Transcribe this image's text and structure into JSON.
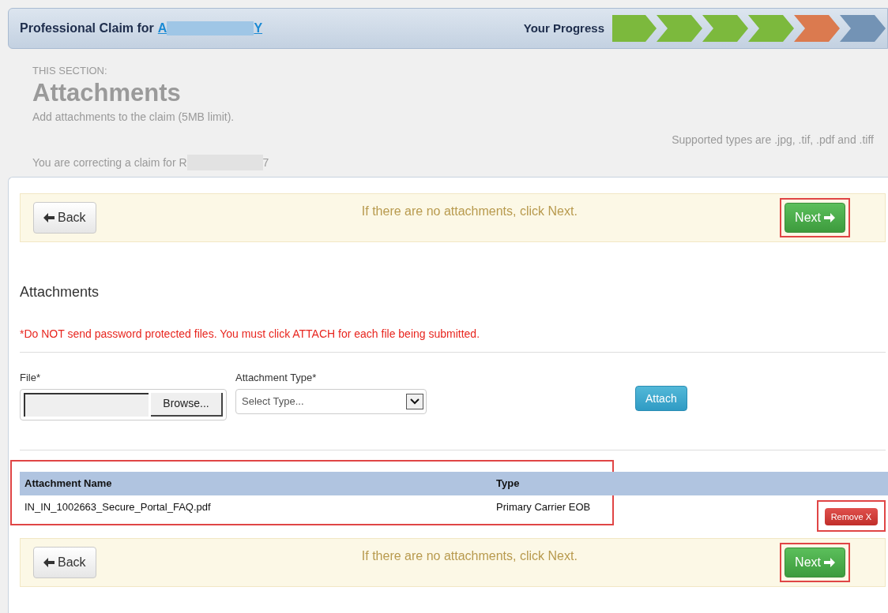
{
  "header": {
    "title": "Professional Claim for",
    "patient_link_start": "A",
    "patient_link_end": "Y",
    "progress_label": "Your Progress",
    "progress_steps": [
      {
        "kind": "done"
      },
      {
        "kind": "done"
      },
      {
        "kind": "done"
      },
      {
        "kind": "done"
      },
      {
        "kind": "current"
      },
      {
        "kind": "todo"
      }
    ]
  },
  "section": {
    "eyebrow": "THIS SECTION:",
    "title": "Attachments",
    "description": "Add attachments to the claim (5MB limit).",
    "supported_types": "Supported types are .jpg, .tif, .pdf and .tiff",
    "correcting_start": "You are correcting a claim for R",
    "correcting_end": "7"
  },
  "nav_top": {
    "back": "Back",
    "message": "If there are no attachments, click Next.",
    "next": "Next",
    "next_highlighted": true
  },
  "attachments": {
    "heading": "Attachments",
    "warning": "*Do NOT send password protected files. You must click ATTACH for each file being submitted.",
    "file_label": "File*",
    "browse": "Browse...",
    "type_label": "Attachment Type*",
    "type_placeholder": "Select Type...",
    "attach": "Attach",
    "table": {
      "highlighted": true,
      "columns": [
        "Attachment Name",
        "Type"
      ],
      "rows": [
        {
          "name": "IN_IN_1002663_Secure_Portal_FAQ.pdf",
          "type": "Primary Carrier EOB",
          "remove": "Remove X",
          "remove_highlighted": true
        }
      ]
    }
  },
  "nav_bottom": {
    "back": "Back",
    "message": "If there are no attachments, click Next.",
    "next": "Next",
    "next_highlighted": true
  }
}
